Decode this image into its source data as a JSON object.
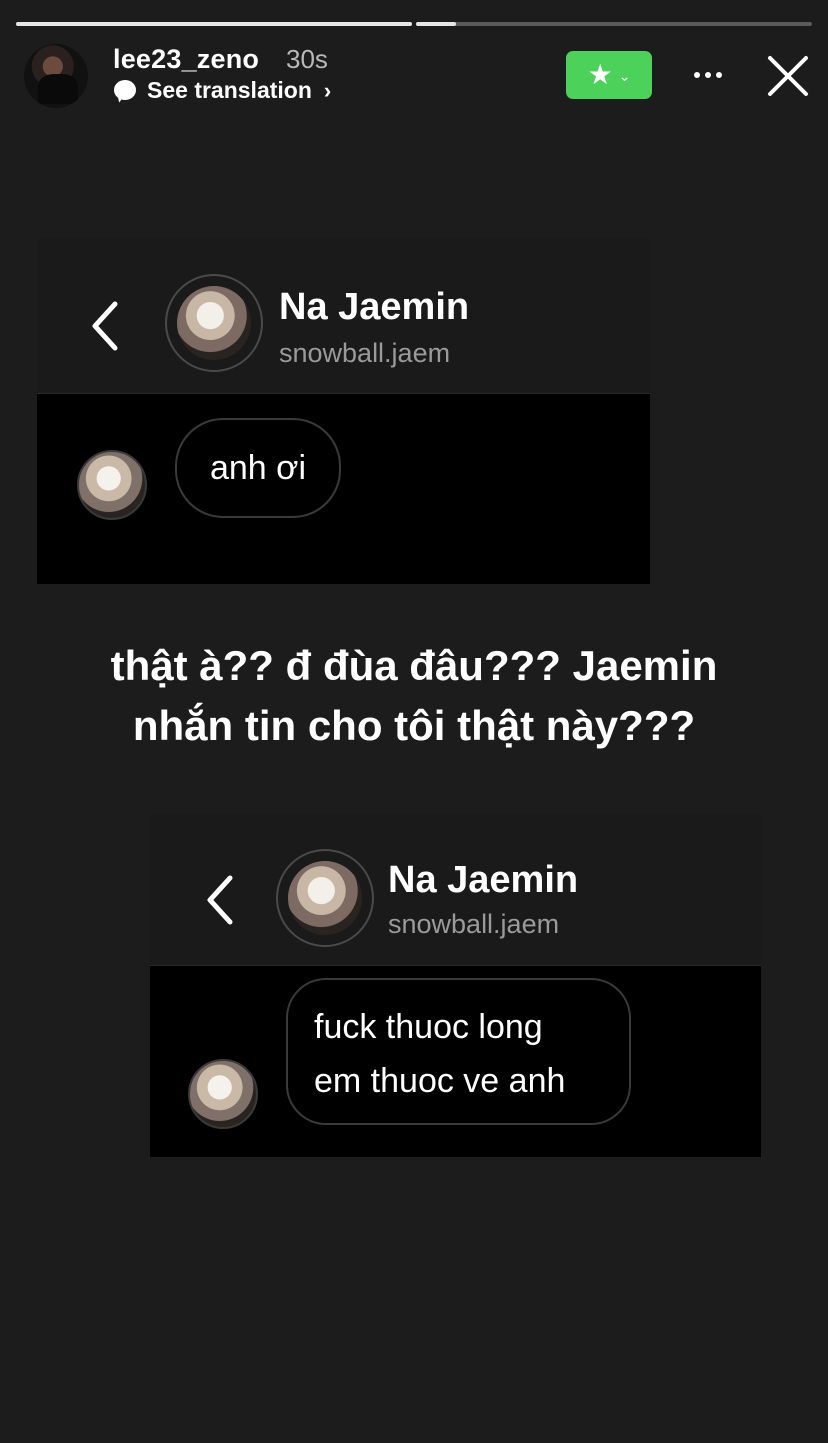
{
  "story": {
    "progress_segments": [
      1.0,
      0.1
    ],
    "username": "lee23_zeno",
    "time": "30s",
    "see_translation": "See translation",
    "favorite_icon": "star-icon",
    "more_icon": "more-dots-icon",
    "close_icon": "close-icon",
    "accent_color": "#4cd15b"
  },
  "screenshots": [
    {
      "name": "Na Jaemin",
      "handle": "snowball.jaem",
      "message_lines": [
        "anh ơi"
      ]
    },
    {
      "name": "Na Jaemin",
      "handle": "snowball.jaem",
      "message_lines": [
        "fuck thuoc long",
        "em thuoc ve anh"
      ]
    }
  ],
  "caption": {
    "line1": "thật à?? đ đùa đâu??? Jaemin",
    "line2": "nhắn tin cho tôi thật này???"
  }
}
